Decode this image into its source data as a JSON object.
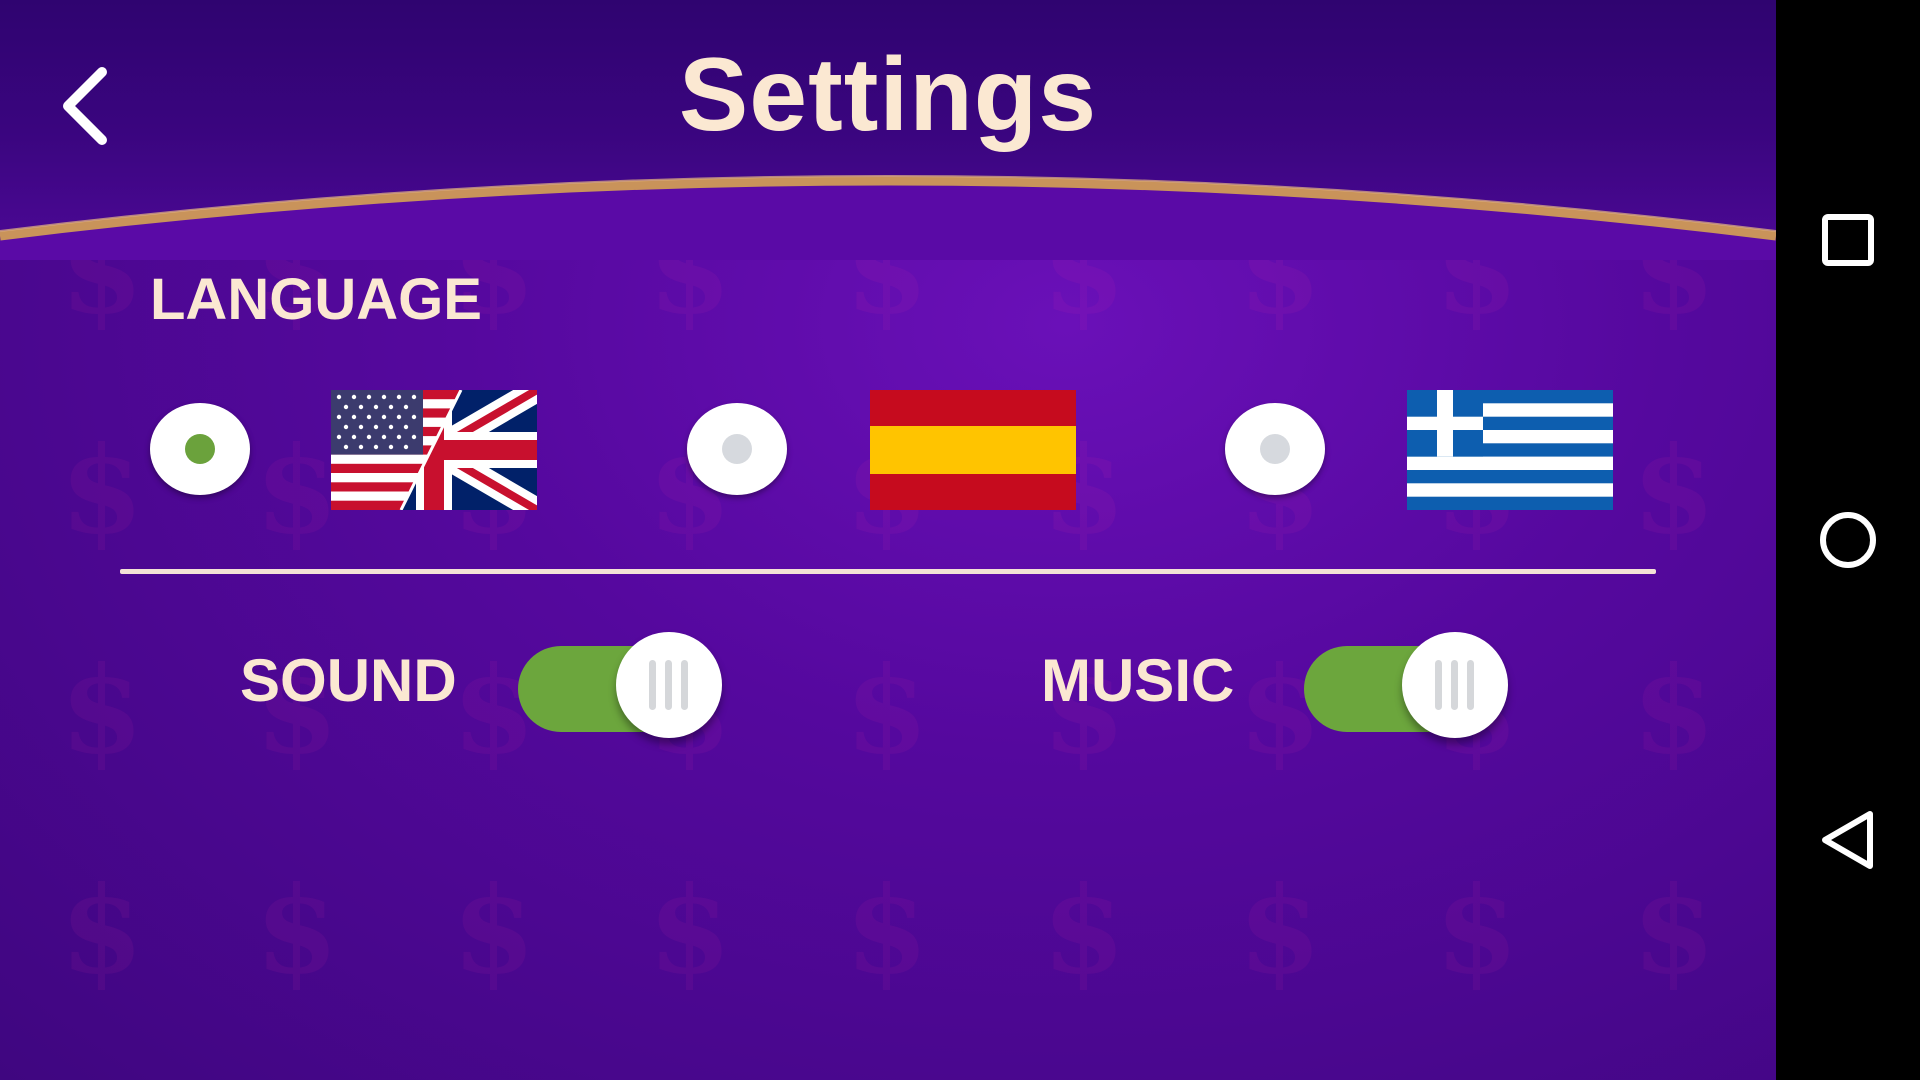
{
  "header": {
    "title": "Settings",
    "back_icon": "chevron-left-icon"
  },
  "language": {
    "label": "LANGUAGE",
    "options": [
      {
        "name": "English",
        "flag_icon": "us-uk-flag-icon",
        "selected": true
      },
      {
        "name": "Spanish",
        "flag_icon": "spain-flag-icon",
        "selected": false
      },
      {
        "name": "Greek",
        "flag_icon": "greece-flag-icon",
        "selected": false
      }
    ]
  },
  "toggles": {
    "sound": {
      "label": "SOUND",
      "on": true
    },
    "music": {
      "label": "MUSIC",
      "on": true
    }
  },
  "navbar": {
    "icons": [
      "square-icon",
      "circle-icon",
      "triangle-back-icon"
    ]
  },
  "colors": {
    "background": "#55089e",
    "header": "#2f0470",
    "accent_gold": "#c9935a",
    "text": "#fbe8d2",
    "toggle_on": "#6ca63d",
    "radio_selected": "#6ba23c"
  }
}
